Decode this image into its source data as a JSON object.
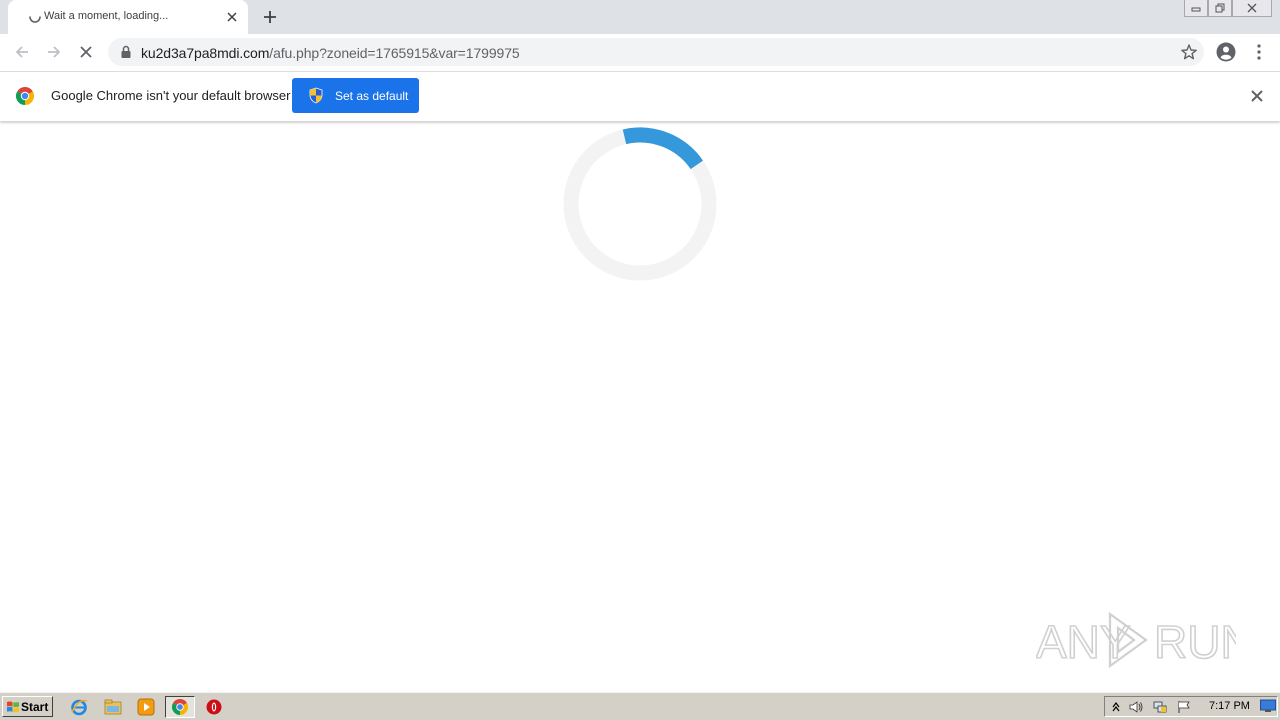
{
  "tab": {
    "title": "Wait a moment, loading...",
    "loading_icon": "tab-loading-spinner-icon",
    "close_icon": "close-icon"
  },
  "new_tab_icon": "plus-icon",
  "window_controls": [
    "minimize-icon",
    "restore-icon",
    "close-icon"
  ],
  "toolbar": {
    "back_icon": "arrow-left-icon",
    "forward_icon": "arrow-right-icon",
    "stop_icon": "stop-x-icon",
    "url_host": "ku2d3a7pa8mdi.com",
    "url_rest": "/afu.php?zoneid=1765915&var=1799975",
    "bookmark_icon": "star-icon",
    "profile_icon": "account-circle-icon",
    "menu_icon": "kebab-menu-icon"
  },
  "infobar": {
    "message": "Google Chrome isn't your default browser",
    "button_label": "Set as default",
    "button_icon": "uac-shield-icon"
  },
  "page": {
    "loader_progress": 0.19,
    "loader_color": "#3498db",
    "loader_track_color": "#f3f3f3"
  },
  "watermark": {
    "text_left": "ANY",
    "text_right": "RUN"
  },
  "taskbar": {
    "start_label": "Start",
    "apps": [
      "internet-explorer-icon",
      "file-explorer-icon",
      "media-player-icon",
      "chrome-icon",
      "opera-icon"
    ],
    "tray_icons": [
      "show-hidden-arrow-icon",
      "volume-icon",
      "network-icon",
      "action-center-flag-icon"
    ],
    "clock": "7:17 PM",
    "show_desktop_icon": "show-desktop-icon"
  },
  "colors": {
    "accent": "#1a73e8",
    "tabstrip_bg": "#dee1e6",
    "taskbar_bg": "#d4d0c8"
  }
}
